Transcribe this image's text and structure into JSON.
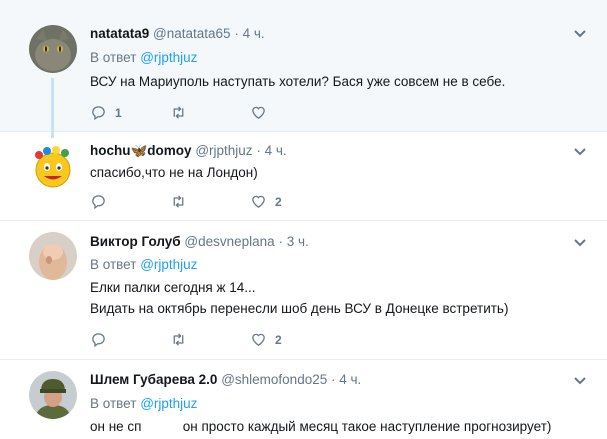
{
  "tweets": [
    {
      "name": "natatata9",
      "handle": "@natatata65",
      "dot": "·",
      "time": "4 ч.",
      "reply_prefix": "В ответ",
      "reply_to": "@rjpthjuz",
      "lines": [
        "ВСУ на Мариуполь наступать хотели? Бася уже совсем не в себе."
      ],
      "replies": "1",
      "retweets": "",
      "likes": ""
    },
    {
      "name": "hochu🦋domoy",
      "handle": "@rjpthjuz",
      "dot": "·",
      "time": "4 ч.",
      "lines": [
        "спасибо,что не на Лондон)"
      ],
      "replies": "",
      "retweets": "",
      "likes": "2"
    },
    {
      "name": "Виктор Голуб",
      "handle": "@desvneplana",
      "dot": "·",
      "time": "3 ч.",
      "reply_prefix": "В ответ",
      "reply_to": "@rjpthjuz",
      "lines": [
        "Елки палки сегодня ж 14...",
        "Видать на октябрь перенесли шоб день ВСУ в Донецке встретить)"
      ],
      "replies": "",
      "retweets": "",
      "likes": "2"
    },
    {
      "name": "Шлем Губарева 2.0",
      "handle": "@shlemofondo25",
      "dot": "·",
      "time": "4 ч.",
      "reply_prefix": "В ответ",
      "reply_to": "@rjpthjuz",
      "lines": [
        "он не сп           он просто каждый месяц такое наступление прогнозирует)"
      ],
      "replies": "",
      "retweets": "",
      "likes": ""
    }
  ],
  "colors": {
    "accent": "#1da1f2",
    "muted": "#657786",
    "thread_line": "#c4e2f8",
    "highlight_bg": "#f5f8fa"
  },
  "icons": {
    "reply": "reply-icon",
    "retweet": "retweet-icon",
    "like": "heart-icon",
    "menu": "chevron-down-icon"
  }
}
